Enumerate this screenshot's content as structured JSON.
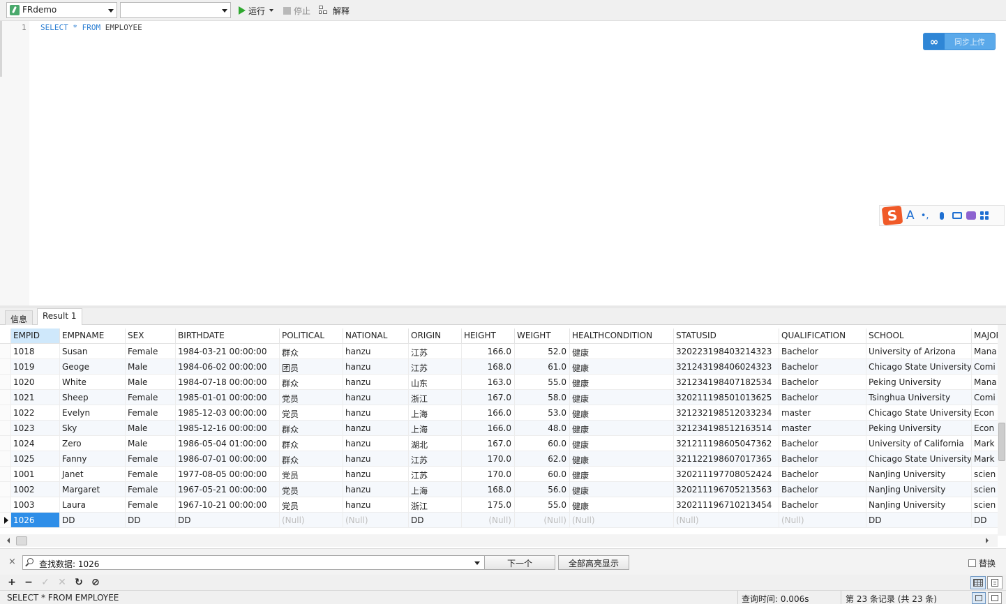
{
  "toolbar": {
    "connection": "FRdemo",
    "database": "",
    "run_label": "运行",
    "stop_label": "停止",
    "explain_label": "解释"
  },
  "editor": {
    "line_number": "1",
    "sql_tokens": [
      {
        "text": "SELECT",
        "kind": "keyword"
      },
      {
        "text": "*",
        "kind": "keyword"
      },
      {
        "text": "FROM",
        "kind": "keyword"
      },
      {
        "text": "EMPLOYEE",
        "kind": "identifier"
      }
    ]
  },
  "cloud_button": {
    "label": "同步上传",
    "icon": "cloud-icon"
  },
  "ime": {
    "logo": "S",
    "letter": "A",
    "punct": "•,"
  },
  "tabs": [
    {
      "label": "信息",
      "active": false
    },
    {
      "label": "Result 1",
      "active": true
    }
  ],
  "grid": {
    "columns": [
      "EMPID",
      "EMPNAME",
      "SEX",
      "BIRTHDATE",
      "POLITICAL",
      "NATIONAL",
      "ORIGIN",
      "HEIGHT",
      "WEIGHT",
      "HEALTHCONDITION",
      "STATUSID",
      "QUALIFICATION",
      "SCHOOL",
      "MAJOR"
    ],
    "rows": [
      [
        "1018",
        "Susan",
        "Female",
        "1984-03-21 00:00:00",
        "群众",
        "hanzu",
        "江苏",
        "166.0",
        "52.0",
        "健康",
        "320223198403214323",
        "Bachelor",
        "University of Arizona",
        "Mana"
      ],
      [
        "1019",
        "Geoge",
        "Male",
        "1984-06-02 00:00:00",
        "团员",
        "hanzu",
        "江苏",
        "168.0",
        "61.0",
        "健康",
        "321243198406024323",
        "Bachelor",
        "Chicago State University",
        "Comi"
      ],
      [
        "1020",
        "White",
        "Male",
        "1984-07-18 00:00:00",
        "群众",
        "hanzu",
        "山东",
        "163.0",
        "55.0",
        "健康",
        "321234198407182534",
        "Bachelor",
        "Peking University",
        "Mana"
      ],
      [
        "1021",
        "Sheep",
        "Female",
        "1985-01-01 00:00:00",
        "党员",
        "hanzu",
        "浙江",
        "167.0",
        "58.0",
        "健康",
        "320211198501013625",
        "Bachelor",
        "Tsinghua University",
        "Comi"
      ],
      [
        "1022",
        "Evelyn",
        "Female",
        "1985-12-03 00:00:00",
        "党员",
        "hanzu",
        "上海",
        "166.0",
        "53.0",
        "健康",
        "321232198512033234",
        "master",
        "Chicago State University",
        "Econ"
      ],
      [
        "1023",
        "Sky",
        "Male",
        "1985-12-16 00:00:00",
        "群众",
        "hanzu",
        "上海",
        "166.0",
        "48.0",
        "健康",
        "321234198512163514",
        "master",
        "Peking University",
        "Econ"
      ],
      [
        "1024",
        "Zero",
        "Male",
        "1986-05-04 01:00:00",
        "群众",
        "hanzu",
        "湖北",
        "167.0",
        "60.0",
        "健康",
        "321211198605047362",
        "Bachelor",
        "University of California",
        "Mark"
      ],
      [
        "1025",
        "Fanny",
        "Female",
        "1986-07-01 00:00:00",
        "群众",
        "hanzu",
        "江苏",
        "170.0",
        "62.0",
        "健康",
        "321122198607017365",
        "Bachelor",
        "Chicago State University",
        "Mark"
      ],
      [
        "1001",
        "Janet",
        "Female",
        "1977-08-05 00:00:00",
        "党员",
        "hanzu",
        "江苏",
        "170.0",
        "60.0",
        "健康",
        "320211197708052424",
        "Bachelor",
        "NanJing University",
        "scien"
      ],
      [
        "1002",
        "Margaret",
        "Female",
        "1967-05-21 00:00:00",
        "党员",
        "hanzu",
        "上海",
        "168.0",
        "56.0",
        "健康",
        "320211196705213563",
        "Bachelor",
        "NanJing University",
        "scien"
      ],
      [
        "1003",
        "Laura",
        "Female",
        "1967-10-21 00:00:00",
        "党员",
        "hanzu",
        "浙江",
        "175.0",
        "55.0",
        "健康",
        "320211196710213454",
        "Bachelor",
        "NanJing University",
        "scien"
      ],
      [
        "1026",
        "DD",
        "DD",
        "DD",
        "(Null)",
        "(Null)",
        "DD",
        "(Null)",
        "(Null)",
        "(Null)",
        "(Null)",
        "(Null)",
        "DD",
        "DD"
      ]
    ],
    "current_row": 11,
    "highlight": "#2e8ee8"
  },
  "findbar": {
    "close_icon": "×",
    "value": "查找数据: 1026",
    "next_label": "下一个",
    "highlight_all_label": "全部高亮显示",
    "replace_label": "替换"
  },
  "bottom_toolbar": {
    "add": "+",
    "remove": "−",
    "apply": "✓",
    "discard": "✕",
    "refresh": "↻",
    "stop": "⊘"
  },
  "status": {
    "sql": "SELECT * FROM EMPLOYEE",
    "query_time": "查询时间: 0.006s",
    "records": "第 23 条记录 (共 23 条)"
  }
}
